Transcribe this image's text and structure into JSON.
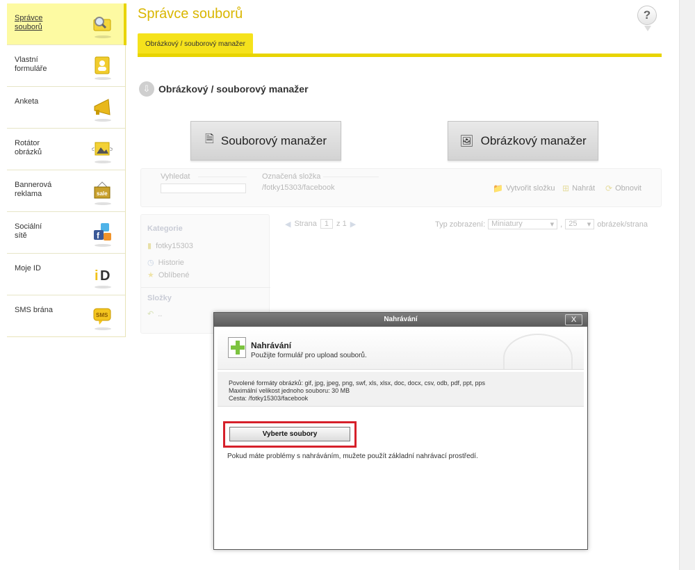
{
  "app": {
    "title": "Správce souborů",
    "help_label": "?"
  },
  "sidebar": {
    "items": [
      {
        "label": "Správce\nsouborů",
        "icon": "folder-search-icon",
        "active": true
      },
      {
        "label": "Vlastní\nformuláře",
        "icon": "contact-card-icon"
      },
      {
        "label": "Anketa",
        "icon": "megaphone-icon"
      },
      {
        "label": "Rotátor\nobrázků",
        "icon": "image-rotator-icon"
      },
      {
        "label": "Bannerová\nreklama",
        "icon": "sale-sign-icon"
      },
      {
        "label": "Sociální\nsítě",
        "icon": "social-networks-icon"
      },
      {
        "label": "Moje ID",
        "icon": "mojeid-icon"
      },
      {
        "label": "SMS brána",
        "icon": "sms-icon"
      }
    ]
  },
  "tabs": [
    {
      "label": "Obrázkový / souborový manažer",
      "active": true
    }
  ],
  "section": {
    "title": "Obrázkový / souborový manažer"
  },
  "buttons": {
    "file_manager": "Souborový manažer",
    "image_manager": "Obrázkový manažer"
  },
  "manager": {
    "search_label": "Vyhledat",
    "folder_label": "Označená složka",
    "folder_path": "/fotky15303/facebook",
    "create_folder": "Vytvořit složku",
    "upload": "Nahrát",
    "refresh": "Obnovit",
    "categories_heading": "Kategorie",
    "categories": [
      "fotky15303",
      "Historie",
      "Oblíbené"
    ],
    "folders_heading": "Složky",
    "folders_item": "..",
    "page_label": "Strana",
    "page_current": "1",
    "page_of": "z 1",
    "view_label": "Typ zobrazení:",
    "view_value": "Miniatury",
    "per_page_value": "25",
    "per_page_label": "obrázek/strana"
  },
  "modal": {
    "title": "Nahrávání",
    "close_label": "X",
    "heading": "Nahrávání",
    "subtitle": "Použijte formulář pro upload souborů.",
    "info_formats": "Povolené formáty obrázků: gif, jpg, jpeg, png, swf, xls, xlsx, doc, docx, csv, odb, pdf, ppt, pps",
    "info_max_size": "Maximální velikost jednoho souboru: 30 MB",
    "info_path": "Cesta: /fotky15303/facebook",
    "choose_files": "Vyberte soubory",
    "hint": "Pokud máte problémy s nahráváním, mužete použít základní nahrávací prostředí."
  },
  "colors": {
    "accent": "#e8d400",
    "active_bg": "#fdfaa2",
    "title": "#d9b600",
    "highlight": "#d6202a"
  }
}
